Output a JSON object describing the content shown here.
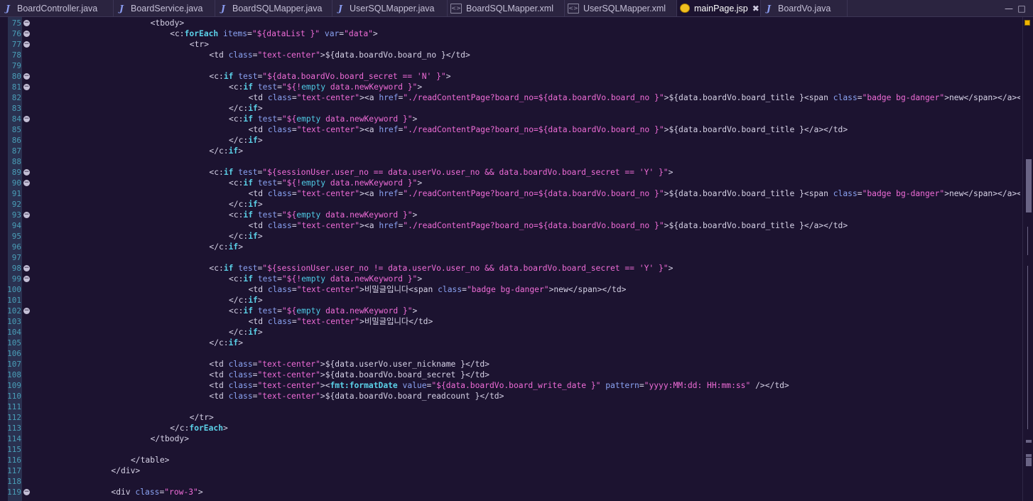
{
  "tabs": [
    {
      "label": "BoardController.java",
      "icon": "java-file-icon",
      "active": false
    },
    {
      "label": "BoardService.java",
      "icon": "java-file-icon",
      "active": false
    },
    {
      "label": "BoardSQLMapper.java",
      "icon": "java-file-icon",
      "active": false
    },
    {
      "label": "UserSQLMapper.java",
      "icon": "java-file-icon",
      "active": false
    },
    {
      "label": "BoardSQLMapper.xml",
      "icon": "xml-file-icon",
      "active": false
    },
    {
      "label": "UserSQLMapper.xml",
      "icon": "xml-file-icon",
      "active": false
    },
    {
      "label": "mainPage.jsp",
      "icon": "jsp-file-icon",
      "active": true
    },
    {
      "label": "BoardVo.java",
      "icon": "java-file-icon",
      "active": false
    }
  ],
  "editor": {
    "first_line": 75,
    "lines": [
      "<tbody>",
      "<c:forEach items=\"${dataList }\" var=\"data\">",
      "<tr>",
      "<td class=\"text-center\">${data.boardVo.board_no }</td>",
      "",
      "<c:if test=\"${data.boardVo.board_secret == 'N' }\">",
      "<c:if test=\"${!empty data.newKeyword }\">",
      "<td class=\"text-center\"><a href=\"./readContentPage?board_no=${data.boardVo.board_no }\">${data.boardVo.board_title }<span class=\"badge bg-danger\">new</span></a></td>",
      "</c:if>",
      "<c:if test=\"${empty data.newKeyword }\">",
      "<td class=\"text-center\"><a href=\"./readContentPage?board_no=${data.boardVo.board_no }\">${data.boardVo.board_title }</a></td>",
      "</c:if>",
      "</c:if>",
      "",
      "<c:if test=\"${sessionUser.user_no == data.userVo.user_no && data.boardVo.board_secret == 'Y' }\">",
      "<c:if test=\"${!empty data.newKeyword }\">",
      "<td class=\"text-center\"><a href=\"./readContentPage?board_no=${data.boardVo.board_no }\">${data.boardVo.board_title }<span class=\"badge bg-danger\">new</span></a></td>",
      "</c:if>",
      "<c:if test=\"${empty data.newKeyword }\">",
      "<td class=\"text-center\"><a href=\"./readContentPage?board_no=${data.boardVo.board_no }\">${data.boardVo.board_title }</a></td>",
      "</c:if>",
      "</c:if>",
      "",
      "<c:if test=\"${sessionUser.user_no != data.userVo.user_no && data.boardVo.board_secret == 'Y' }\">",
      "<c:if test=\"${!empty data.newKeyword }\">",
      "<td class=\"text-center\">비밀글입니다<span class=\"badge bg-danger\">new</span></td>",
      "</c:if>",
      "<c:if test=\"${empty data.newKeyword }\">",
      "<td class=\"text-center\">비밀글입니다</td>",
      "</c:if>",
      "</c:if>",
      "",
      "<td class=\"text-center\">${data.userVo.user_nickname }</td>",
      "<td class=\"text-center\">${data.boardVo.board_secret }</td>",
      "<td class=\"text-center\"><fmt:formatDate value=\"${data.boardVo.board_write_date }\" pattern=\"yyyy:MM:dd: HH:mm:ss\" /></td>",
      "<td class=\"text-center\">${data.boardVo.board_readcount }</td>",
      "",
      "</tr>",
      "</c:forEach>",
      "</tbody>",
      "",
      "</table>",
      "</div>",
      "",
      "<div class=\"row-3\">"
    ],
    "indent_levels": [
      6,
      7,
      8,
      9,
      0,
      9,
      10,
      11,
      10,
      10,
      11,
      10,
      9,
      0,
      9,
      10,
      11,
      10,
      10,
      11,
      10,
      9,
      0,
      9,
      10,
      11,
      10,
      10,
      11,
      10,
      9,
      0,
      9,
      9,
      9,
      9,
      0,
      8,
      7,
      6,
      0,
      5,
      4,
      0,
      4
    ],
    "folding_lines": [
      75,
      76,
      77,
      80,
      81,
      84,
      89,
      90,
      93,
      98,
      99,
      102,
      119
    ]
  }
}
